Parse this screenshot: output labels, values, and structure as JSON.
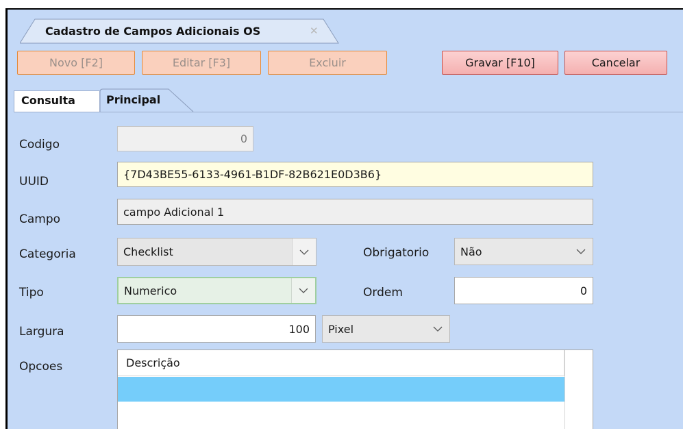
{
  "window": {
    "doc_tab_title": "Cadastro de Campos Adicionais OS",
    "doc_tab_close_glyph": "✕"
  },
  "toolbar": {
    "novo_label": "Novo [F2]",
    "editar_label": "Editar [F3]",
    "excluir_label": "Excluir",
    "gravar_label": "Gravar [F10]",
    "cancelar_label": "Cancelar"
  },
  "tabs": {
    "consulta": "Consulta",
    "principal": "Principal"
  },
  "form": {
    "codigo": {
      "label": "Codigo",
      "value": "0"
    },
    "uuid": {
      "label": "UUID",
      "value": "{7D43BE55-6133-4961-B1DF-82B621E0D3B6}"
    },
    "campo": {
      "label": "Campo",
      "value": "campo Adicional 1"
    },
    "categoria": {
      "label": "Categoria",
      "value": "Checklist"
    },
    "obrigatorio": {
      "label": "Obrigatorio",
      "value": "Não"
    },
    "tipo": {
      "label": "Tipo",
      "value": "Numerico"
    },
    "ordem": {
      "label": "Ordem",
      "value": "0"
    },
    "largura": {
      "label": "Largura",
      "value": "100",
      "unit": "Pixel"
    },
    "opcoes": {
      "label": "Opcoes",
      "column_header": "Descrição"
    }
  },
  "colors": {
    "background": "#c4d9f7",
    "disabled_button": "#fad0bd",
    "active_button": "#f4b0b0",
    "uuid_field": "#fffde1",
    "selected_row": "#75cdfa"
  }
}
